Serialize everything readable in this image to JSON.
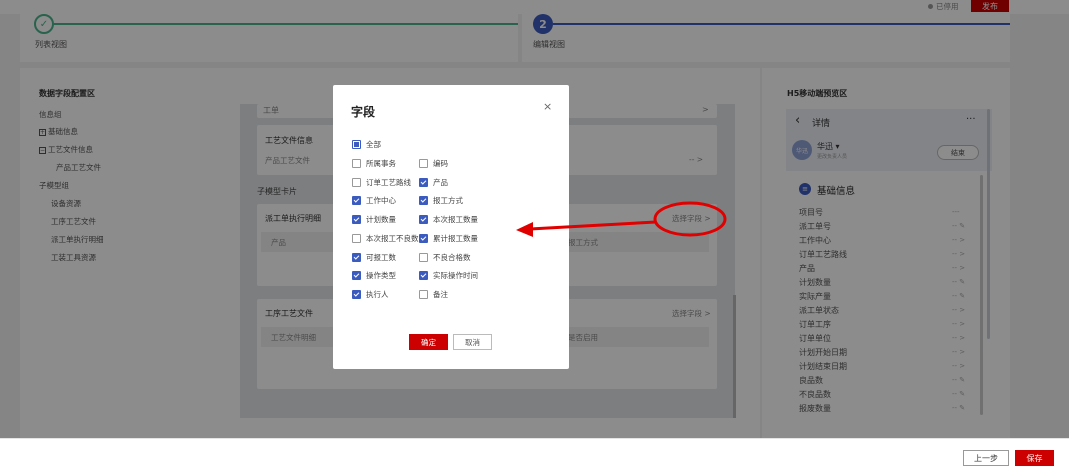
{
  "top": {
    "status_text": "已停用",
    "publish_label": "发布"
  },
  "steps": {
    "step1_label": "列表视图",
    "step2_label": "编辑视图",
    "step2_number": "2"
  },
  "left_panel": {
    "title": "数据字段配置区",
    "tree": {
      "info_group": "信息组",
      "basic_info": "基础信息",
      "process_file_info": "工艺文件信息",
      "product_process_file": "产品工艺文件",
      "submodel_group": "子模型组",
      "equipment": "设备资源",
      "process_files": "工序工艺文件",
      "dispatch_detail": "派工单执行明细",
      "tool_resource": "工装工具资源"
    }
  },
  "center": {
    "card1_title": "工艺文件信息",
    "card1_field": "产品工艺文件",
    "card1_value": "-- >",
    "submodel_label": "子模型卡片",
    "card2_title": "派工单执行明细",
    "card2_select": "选择字段 >",
    "card2_col1": "产品",
    "card2_col2": "报工方式",
    "card3_title": "工序工艺文件",
    "card3_select": "选择字段 >",
    "card3_col1": "工艺文件明细",
    "card3_col2": "是否启用",
    "cut_top": "工单",
    "cut_arrow": ">"
  },
  "right_panel": {
    "title": "H5移动端预览区",
    "back_icon": "chevron-left-icon",
    "detail_title": "详情",
    "more": "···",
    "avatar": "华迅",
    "user_name": "华迅 ▾",
    "user_sub": "更改负责人员",
    "end_button": "结束",
    "section_title": "基础信息",
    "rows": [
      {
        "label": "项目号",
        "value": "---"
      },
      {
        "label": "派工单号",
        "value": "--  ✎"
      },
      {
        "label": "工作中心",
        "value": "--  >"
      },
      {
        "label": "订单工艺路线",
        "value": "--  >"
      },
      {
        "label": "产品",
        "value": "--  >"
      },
      {
        "label": "计划数量",
        "value": "--  ✎"
      },
      {
        "label": "实际产量",
        "value": "--  ✎"
      },
      {
        "label": "派工单状态",
        "value": "--  >"
      },
      {
        "label": "订单工序",
        "value": "--  >"
      },
      {
        "label": "订单单位",
        "value": "--  >"
      },
      {
        "label": "计划开始日期",
        "value": "--  >"
      },
      {
        "label": "计划结束日期",
        "value": "--  >"
      },
      {
        "label": "良品数",
        "value": "--  ✎"
      },
      {
        "label": "不良品数",
        "value": "--  ✎"
      },
      {
        "label": "报废数量",
        "value": "--  ✎"
      }
    ]
  },
  "bottom": {
    "prev_label": "上一步",
    "save_label": "保存"
  },
  "modal": {
    "title": "字段",
    "close": "×",
    "all_label": "全部",
    "options": [
      {
        "label": "所属事务",
        "checked": false
      },
      {
        "label": "编码",
        "checked": false
      },
      {
        "label": "订单工艺路线",
        "checked": false
      },
      {
        "label": "产品",
        "checked": true
      },
      {
        "label": "工作中心",
        "checked": true
      },
      {
        "label": "报工方式",
        "checked": true
      },
      {
        "label": "计划数量",
        "checked": true
      },
      {
        "label": "本次报工数量",
        "checked": true
      },
      {
        "label": "本次报工不良数",
        "checked": false
      },
      {
        "label": "累计报工数量",
        "checked": true
      },
      {
        "label": "可报工数",
        "checked": true
      },
      {
        "label": "不良合格数",
        "checked": false
      },
      {
        "label": "操作类型",
        "checked": true
      },
      {
        "label": "实际操作时间",
        "checked": true
      },
      {
        "label": "执行人",
        "checked": true
      },
      {
        "label": "备注",
        "checked": false
      }
    ],
    "ok_label": "确定",
    "cancel_label": "取消"
  },
  "colors": {
    "primary_red": "#cc0000",
    "step_done": "#4cb58c",
    "step_active": "#3b5bbf",
    "annotation": "#e00000"
  }
}
